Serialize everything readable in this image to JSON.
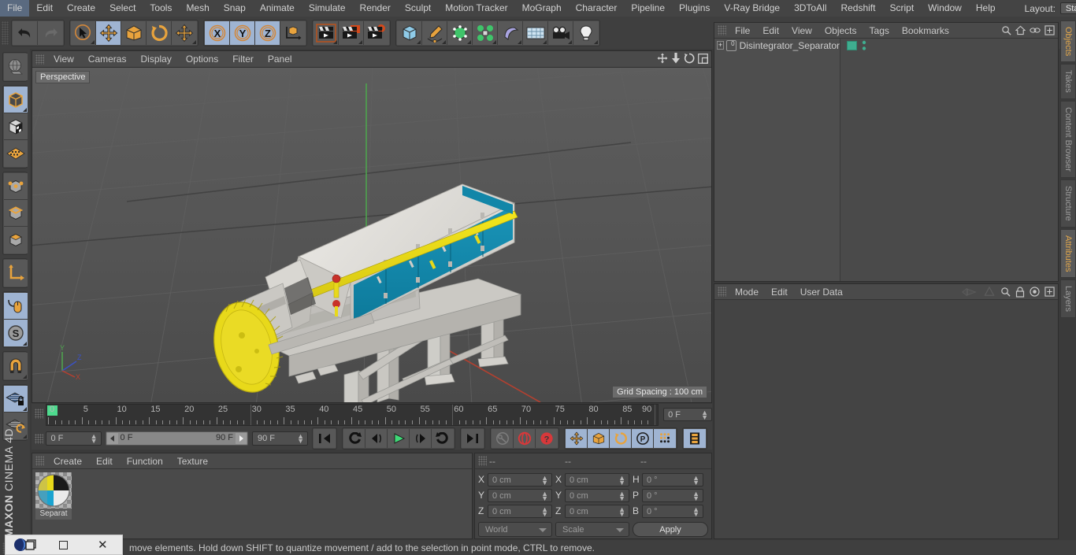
{
  "app": {
    "name": "MAXON CINEMA 4D",
    "brand_line1": "MAXON",
    "brand_line2": "CINEMA 4D"
  },
  "menubar": {
    "items": [
      {
        "label": "File"
      },
      {
        "label": "Edit"
      },
      {
        "label": "Create"
      },
      {
        "label": "Select"
      },
      {
        "label": "Tools"
      },
      {
        "label": "Mesh"
      },
      {
        "label": "Snap"
      },
      {
        "label": "Animate"
      },
      {
        "label": "Simulate"
      },
      {
        "label": "Render"
      },
      {
        "label": "Sculpt"
      },
      {
        "label": "Motion Tracker"
      },
      {
        "label": "MoGraph"
      },
      {
        "label": "Character"
      },
      {
        "label": "Pipeline"
      },
      {
        "label": "Plugins"
      },
      {
        "label": "V-Ray Bridge"
      },
      {
        "label": "3DToAll"
      },
      {
        "label": "Redshift"
      },
      {
        "label": "Script"
      },
      {
        "label": "Window"
      },
      {
        "label": "Help"
      }
    ],
    "layout_label": "Layout:",
    "layout_value": "Startup",
    "search_icon": "search-icon"
  },
  "toolbar": {
    "groups": [
      {
        "name": "history",
        "buttons": [
          {
            "name": "undo-button",
            "icon": "undo-arrow-icon",
            "active": false,
            "corner": false
          },
          {
            "name": "redo-button",
            "icon": "redo-arrow-icon",
            "active": false,
            "corner": false
          }
        ]
      },
      {
        "name": "transform",
        "buttons": [
          {
            "name": "live-selection-tool",
            "icon": "cursor-circle-icon",
            "active": false,
            "corner": true
          },
          {
            "name": "move-tool",
            "icon": "move-arrows-icon",
            "active": true,
            "corner": false
          },
          {
            "name": "scale-tool",
            "icon": "scale-box-icon",
            "active": false,
            "corner": false
          },
          {
            "name": "rotate-tool",
            "icon": "rotate-ring-icon",
            "active": false,
            "corner": false
          },
          {
            "name": "soft-selection-tool",
            "icon": "move-arrows-icon",
            "active": false,
            "corner": true
          }
        ]
      },
      {
        "name": "axis-locks",
        "buttons": [
          {
            "name": "x-axis-lock",
            "icon": "x-axis-icon",
            "label": "X",
            "active": true,
            "corner": false
          },
          {
            "name": "y-axis-lock",
            "icon": "y-axis-icon",
            "label": "Y",
            "active": true,
            "corner": false
          },
          {
            "name": "z-axis-lock",
            "icon": "z-axis-icon",
            "label": "Z",
            "active": true,
            "corner": false
          },
          {
            "name": "world-object-axis-toggle",
            "icon": "world-axis-cube-icon",
            "active": false,
            "corner": false
          }
        ]
      },
      {
        "name": "render",
        "buttons": [
          {
            "name": "render-view-button",
            "icon": "clapperboard-icon",
            "active": false,
            "corner": true
          },
          {
            "name": "render-to-picture-viewer-button",
            "icon": "clapperboard-window-icon",
            "active": false,
            "corner": true
          },
          {
            "name": "render-settings-button",
            "icon": "clapperboard-gear-icon",
            "active": false,
            "corner": false
          }
        ]
      },
      {
        "name": "create",
        "buttons": [
          {
            "name": "cube-primitive-button",
            "icon": "blue-cube-icon",
            "active": false,
            "corner": true
          },
          {
            "name": "spline-pen-button",
            "icon": "pen-spline-icon",
            "active": false,
            "corner": true
          },
          {
            "name": "nurbs-generator-button",
            "icon": "green-cube-icon",
            "active": false,
            "corner": true
          },
          {
            "name": "array-modeling-button",
            "icon": "green-cluster-icon",
            "active": false,
            "corner": true
          },
          {
            "name": "deformer-button",
            "icon": "purple-bend-icon",
            "active": false,
            "corner": true
          },
          {
            "name": "scene-object-button",
            "icon": "floor-grid-icon",
            "active": false,
            "corner": true
          },
          {
            "name": "camera-button",
            "icon": "camera-icon",
            "active": false,
            "corner": true
          },
          {
            "name": "light-button",
            "icon": "light-bulb-icon",
            "active": false,
            "corner": true
          }
        ]
      }
    ]
  },
  "leftbar": {
    "groups": [
      {
        "buttons": [
          {
            "name": "texture-axis-mode",
            "icon": "globe-texture-icon",
            "active": false,
            "corner": false
          }
        ]
      },
      {
        "buttons": [
          {
            "name": "model-mode",
            "icon": "grey-cube-icon",
            "active": true,
            "corner": true
          },
          {
            "name": "texture-mode",
            "icon": "checker-cube-icon",
            "active": false,
            "corner": false
          },
          {
            "name": "polygon-grid-mode",
            "icon": "orange-grid-icon",
            "active": false,
            "corner": false
          }
        ]
      },
      {
        "buttons": [
          {
            "name": "points-mode",
            "icon": "cube-points-icon",
            "active": false,
            "corner": false
          },
          {
            "name": "edges-mode",
            "icon": "cube-edges-icon",
            "active": false,
            "corner": false
          },
          {
            "name": "polygons-mode",
            "icon": "cube-polygons-icon",
            "active": false,
            "corner": false
          }
        ]
      },
      {
        "buttons": [
          {
            "name": "axis-modify-mode",
            "icon": "orange-axis-icon",
            "active": false,
            "corner": false
          }
        ]
      },
      {
        "buttons": [
          {
            "name": "enable-axis-mode",
            "icon": "mouse-axis-icon",
            "active": true,
            "corner": false
          },
          {
            "name": "soft-interaction-mode",
            "icon": "s-compass-icon",
            "active": true,
            "corner": true
          }
        ]
      },
      {
        "buttons": [
          {
            "name": "snap-magnet-tool",
            "icon": "magnet-icon",
            "active": false,
            "corner": true
          }
        ]
      },
      {
        "buttons": [
          {
            "name": "workplane-lock",
            "icon": "grid-lock-icon",
            "active": true,
            "corner": true
          },
          {
            "name": "workplane-reset",
            "icon": "grid-reset-icon",
            "active": false,
            "corner": true
          }
        ]
      }
    ]
  },
  "viewport": {
    "menu": [
      {
        "label": "View"
      },
      {
        "label": "Cameras"
      },
      {
        "label": "Display"
      },
      {
        "label": "Options"
      },
      {
        "label": "Filter"
      },
      {
        "label": "Panel"
      }
    ],
    "nav_icons": [
      {
        "name": "pan-view-icon"
      },
      {
        "name": "dolly-view-icon"
      },
      {
        "name": "rotate-view-icon"
      },
      {
        "name": "maximize-view-icon"
      }
    ],
    "label": "Perspective",
    "grid_spacing": "Grid Spacing : 100 cm",
    "gizmo_axes": [
      "Y",
      "Z",
      "X"
    ],
    "scene_object": "Disintegrator_Separator",
    "colors": {
      "background_top": "#5a5a5a",
      "background_bottom": "#4a4a4a",
      "body_grey": "#d8d8d6",
      "panel_teal": "#1286a8",
      "accent_yellow": "#e8d91a",
      "x_axis": "#c0392b",
      "y_axis": "#3fae55",
      "z_axis": "#3b4fc0"
    }
  },
  "timeline": {
    "min": 0,
    "max": 90,
    "major_ticks": [
      0,
      5,
      10,
      15,
      20,
      25,
      30,
      35,
      40,
      45,
      50,
      55,
      60,
      65,
      70,
      75,
      80,
      85,
      90
    ],
    "current_frame_field": "0 F",
    "playhead_frame": 0
  },
  "animbar": {
    "current_frame": "0 F",
    "range_start": "0 F",
    "range_end": "90 F",
    "end_frame": "90 F",
    "buttons": [
      {
        "name": "go-to-start-button",
        "icon": "skip-start-icon",
        "active": false
      },
      {
        "name": "go-to-previous-key-button",
        "icon": "prev-key-icon",
        "active": false
      },
      {
        "name": "go-to-previous-frame-button",
        "icon": "step-back-icon",
        "active": false
      },
      {
        "name": "play-button",
        "icon": "play-icon",
        "active": false
      },
      {
        "name": "go-to-next-frame-button",
        "icon": "step-forward-icon",
        "active": false
      },
      {
        "name": "go-to-next-key-button",
        "icon": "next-key-icon",
        "active": false
      },
      {
        "name": "go-to-end-button",
        "icon": "skip-end-icon",
        "active": false
      },
      {
        "name": "record-active-objects-button",
        "icon": "key-icon",
        "active": false
      },
      {
        "name": "autokeying-button",
        "icon": "red-circle-icon",
        "active": false
      },
      {
        "name": "keyframe-selection-button",
        "icon": "red-question-icon",
        "active": false
      },
      {
        "name": "position-key-toggle",
        "icon": "move-arrows-icon",
        "active": true
      },
      {
        "name": "scale-key-toggle",
        "icon": "scale-box-icon",
        "active": true
      },
      {
        "name": "rotation-key-toggle",
        "icon": "rotate-ring-icon",
        "active": true
      },
      {
        "name": "param-key-toggle",
        "icon": "p-circle-icon",
        "active": true
      },
      {
        "name": "pla-key-toggle",
        "icon": "point-level-icon",
        "active": true
      },
      {
        "name": "timeline-filmstrip-button",
        "icon": "filmstrip-icon",
        "active": true
      }
    ]
  },
  "material_manager": {
    "menu": [
      {
        "label": "Create"
      },
      {
        "label": "Edit"
      },
      {
        "label": "Function"
      },
      {
        "label": "Texture"
      }
    ],
    "materials": [
      {
        "name": "Separator",
        "display": "Separat",
        "colors": [
          "#e8d91a",
          "#1aa3d0",
          "#1e1e1e",
          "#e6e6e6"
        ]
      }
    ]
  },
  "coordinates": {
    "headers": [
      "--",
      "--",
      "--"
    ],
    "position": {
      "labels": [
        "X",
        "Y",
        "Z"
      ],
      "values": [
        "0 cm",
        "0 cm",
        "0 cm"
      ]
    },
    "size": {
      "labels": [
        "X",
        "Y",
        "Z"
      ],
      "values": [
        "0 cm",
        "0 cm",
        "0 cm"
      ]
    },
    "rotation": {
      "labels": [
        "H",
        "P",
        "B"
      ],
      "values": [
        "0 °",
        "0 °",
        "0 °"
      ]
    },
    "coord_system": "World",
    "size_mode": "Scale",
    "apply_label": "Apply"
  },
  "object_manager": {
    "menu": [
      {
        "label": "File"
      },
      {
        "label": "Edit"
      },
      {
        "label": "View"
      },
      {
        "label": "Objects"
      },
      {
        "label": "Tags"
      },
      {
        "label": "Bookmarks"
      }
    ],
    "icons": [
      {
        "name": "search-icon"
      },
      {
        "name": "home-icon"
      },
      {
        "name": "link-icon"
      },
      {
        "name": "new-window-icon"
      }
    ],
    "objects": [
      {
        "name": "Disintegrator_Separator",
        "expandable": true,
        "tag_color": "#3fae90",
        "visible_dots": true
      }
    ]
  },
  "attribute_manager": {
    "menu": [
      {
        "label": "Mode"
      },
      {
        "label": "Edit"
      },
      {
        "label": "User Data"
      }
    ],
    "icons": [
      {
        "name": "interface-arrow-icon"
      },
      {
        "name": "cone-icon"
      },
      {
        "name": "search-icon"
      },
      {
        "name": "lock-icon"
      },
      {
        "name": "target-icon"
      },
      {
        "name": "new-window-icon"
      }
    ]
  },
  "vertical_tabs": [
    {
      "label": "Objects",
      "selected": true
    },
    {
      "label": "Takes",
      "selected": false
    },
    {
      "label": "Content Browser",
      "selected": false
    },
    {
      "label": "Structure",
      "selected": false
    },
    {
      "label": "Attributes",
      "selected": true
    },
    {
      "label": "Layers",
      "selected": false
    }
  ],
  "statusbar": {
    "text": "move elements. Hold down SHIFT to quantize movement / add to the selection in point mode, CTRL to remove."
  },
  "taskbar": {
    "items": [
      {
        "name": "app-icon",
        "icon": "cinema4d-logo-icon"
      },
      {
        "name": "restore-window-button",
        "icon": "restore-icon"
      },
      {
        "name": "close-window-button",
        "icon": "close-icon"
      }
    ]
  }
}
